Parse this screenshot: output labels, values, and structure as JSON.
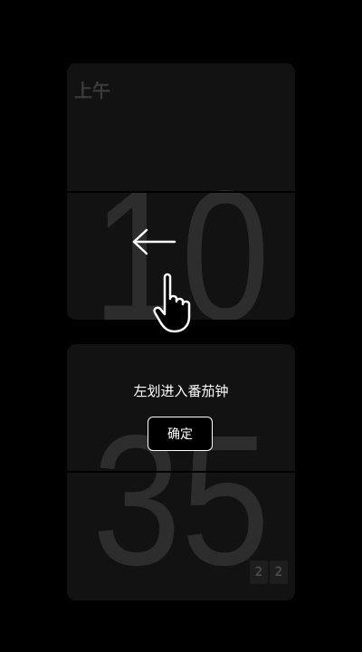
{
  "clock": {
    "ampm": "上午",
    "hour": "10",
    "minute": "35",
    "seconds": [
      "2",
      "2"
    ]
  },
  "guide": {
    "hint": "左划进入番茄钟",
    "confirm_label": "确定",
    "arrow_icon": "left-arrow-icon",
    "hand_icon": "pointing-hand-icon"
  },
  "colors": {
    "background": "#000000",
    "card": "#121212",
    "digit": "#2d2d2d",
    "overlay_text": "#ffffff"
  }
}
